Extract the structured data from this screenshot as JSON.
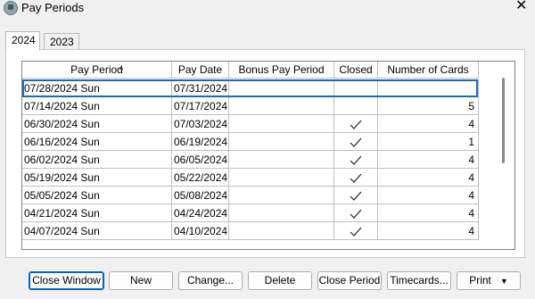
{
  "window": {
    "title": "Pay Periods",
    "close_glyph": "✕"
  },
  "tabs": [
    {
      "label": "2024"
    },
    {
      "label": "2023"
    }
  ],
  "grid": {
    "columns": [
      "Pay Period",
      "Pay Date",
      "Bonus Pay Period",
      "Closed",
      "Number of Cards"
    ],
    "rows": [
      {
        "period": "07/28/2024 Sun",
        "pay_date": "07/31/2024",
        "bonus": "",
        "closed": false,
        "cards": ""
      },
      {
        "period": "07/14/2024 Sun",
        "pay_date": "07/17/2024",
        "bonus": "",
        "closed": false,
        "cards": "5"
      },
      {
        "period": "06/30/2024 Sun",
        "pay_date": "07/03/2024",
        "bonus": "",
        "closed": true,
        "cards": "4"
      },
      {
        "period": "06/16/2024 Sun",
        "pay_date": "06/19/2024",
        "bonus": "",
        "closed": true,
        "cards": "1"
      },
      {
        "period": "06/02/2024 Sun",
        "pay_date": "06/05/2024",
        "bonus": "",
        "closed": true,
        "cards": "4"
      },
      {
        "period": "05/19/2024 Sun",
        "pay_date": "05/22/2024",
        "bonus": "",
        "closed": true,
        "cards": "4"
      },
      {
        "period": "05/05/2024 Sun",
        "pay_date": "05/08/2024",
        "bonus": "",
        "closed": true,
        "cards": "4"
      },
      {
        "period": "04/21/2024 Sun",
        "pay_date": "04/24/2024",
        "bonus": "",
        "closed": true,
        "cards": "4"
      },
      {
        "period": "04/07/2024 Sun",
        "pay_date": "04/10/2024",
        "bonus": "",
        "closed": true,
        "cards": "4"
      }
    ]
  },
  "buttons": {
    "close_window": "Close Window",
    "new": "New",
    "change": "Change...",
    "delete": "Delete",
    "close_period": "Close Period",
    "timecards": "Timecards...",
    "print": "Print"
  },
  "colors": {
    "selection_outline": "#1a69b5",
    "default_button": "#0067c0"
  }
}
